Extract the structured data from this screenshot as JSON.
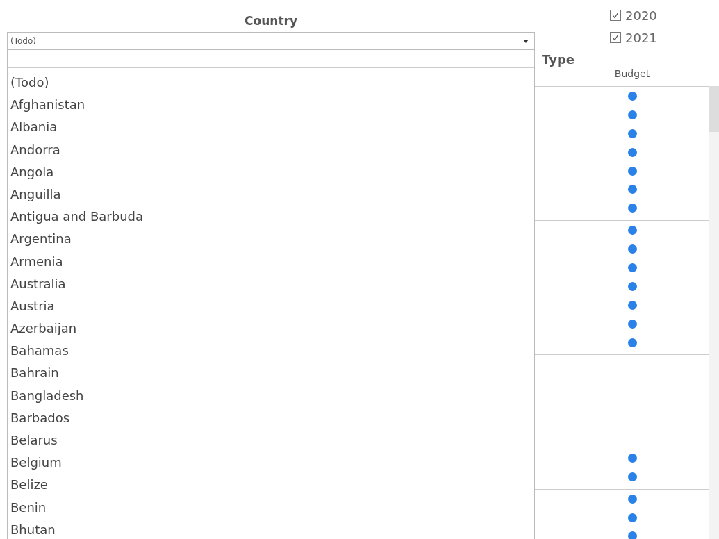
{
  "filter": {
    "title": "Country",
    "value": "(Todo)",
    "items": [
      "(Todo)",
      "Afghanistan",
      "Albania",
      "Andorra",
      "Angola",
      "Anguilla",
      "Antigua and Barbuda",
      "Argentina",
      "Armenia",
      "Australia",
      "Austria",
      "Azerbaijan",
      "Bahamas",
      "Bahrain",
      "Bangladesh",
      "Barbados",
      "Belarus",
      "Belgium",
      "Belize",
      "Benin",
      "Bhutan"
    ]
  },
  "years": [
    {
      "label": "2020",
      "checked": true
    },
    {
      "label": "2021",
      "checked": true
    }
  ],
  "table": {
    "title": "Type",
    "column": "Budget",
    "groups": [
      {
        "rows": [
          {
            "dot": true
          },
          {
            "dot": true
          },
          {
            "dot": true
          },
          {
            "dot": true
          },
          {
            "dot": true
          },
          {
            "dot": true
          },
          {
            "dot": true
          }
        ]
      },
      {
        "rows": [
          {
            "dot": true
          },
          {
            "dot": true
          },
          {
            "dot": true
          },
          {
            "dot": true
          },
          {
            "dot": true
          },
          {
            "dot": true
          },
          {
            "dot": true
          }
        ]
      },
      {
        "rows": [
          {
            "dot": false
          },
          {
            "dot": false
          },
          {
            "dot": false
          },
          {
            "dot": false
          },
          {
            "dot": false
          },
          {
            "dot": true
          },
          {
            "dot": true
          }
        ]
      },
      {
        "rows": [
          {
            "dot": true
          },
          {
            "dot": true
          },
          {
            "dot": true
          }
        ]
      }
    ]
  }
}
